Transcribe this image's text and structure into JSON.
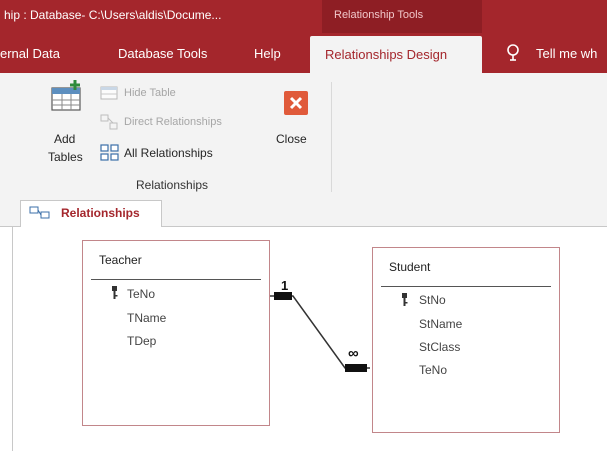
{
  "titlebar": {
    "title": "hip : Database- C:\\Users\\aldis\\Docume...",
    "context_title": "Relationship Tools"
  },
  "ribbon_tabs": {
    "external_data": "ernal Data",
    "database_tools": "Database Tools",
    "help": "Help",
    "relationships_design": "Relationships Design",
    "tell_me": "Tell me wh"
  },
  "ribbon": {
    "add_tables_line1": "Add",
    "add_tables_line2": "Tables",
    "hide_table": "Hide Table",
    "direct_relationships": "Direct Relationships",
    "all_relationships": "All Relationships",
    "close": "Close",
    "group_label": "Relationships"
  },
  "document_tab": {
    "label": "Relationships"
  },
  "tables": [
    {
      "name": "Teacher",
      "fields": [
        "TeNo",
        "TName",
        "TDep"
      ],
      "primary_key": "TeNo"
    },
    {
      "name": "Student",
      "fields": [
        "StNo",
        "StName",
        "StClass",
        "TeNo"
      ],
      "primary_key": "StNo"
    }
  ],
  "relationship": {
    "one_side": "1",
    "many_side": "∞"
  },
  "colors": {
    "accent": "#a4262c",
    "ribbon_bg": "#f3f3f3",
    "table_border": "#c2868a",
    "close_icon": "#e05a3a"
  }
}
